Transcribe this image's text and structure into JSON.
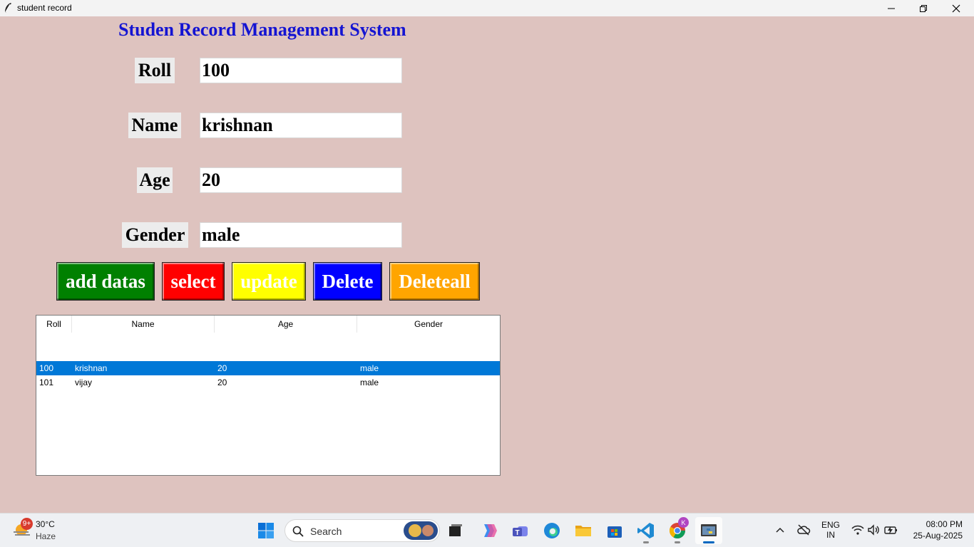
{
  "window": {
    "title": "student record"
  },
  "app": {
    "title": "Studen Record Management System",
    "fields": [
      {
        "label": "Roll",
        "value": "100"
      },
      {
        "label": "Name",
        "value": "krishnan"
      },
      {
        "label": "Age",
        "value": "20"
      },
      {
        "label": "Gender",
        "value": "male"
      }
    ],
    "buttons": [
      {
        "label": "add datas",
        "color": "#008000"
      },
      {
        "label": "select",
        "color": "#ff0000"
      },
      {
        "label": "update",
        "color": "#ffff00"
      },
      {
        "label": "Delete",
        "color": "#0000ff"
      },
      {
        "label": "Deleteall",
        "color": "#ffa500"
      }
    ],
    "table": {
      "columns": [
        "Roll",
        "Name",
        "Age",
        "Gender"
      ],
      "rows": [
        {
          "cells": [
            "100",
            "krishnan",
            "20",
            "male"
          ],
          "selected": true
        },
        {
          "cells": [
            "101",
            "vijay",
            "20",
            "male"
          ],
          "selected": false
        }
      ]
    }
  },
  "taskbar": {
    "weather": {
      "badge": "9+",
      "temp": "30°C",
      "desc": "Haze"
    },
    "search_placeholder": "Search",
    "chrome_badge": "K",
    "tray": {
      "lang1": "ENG",
      "lang2": "IN",
      "time": "08:00 PM",
      "date": "25-Aug-2025"
    },
    "selection_color": "#0078d7"
  }
}
